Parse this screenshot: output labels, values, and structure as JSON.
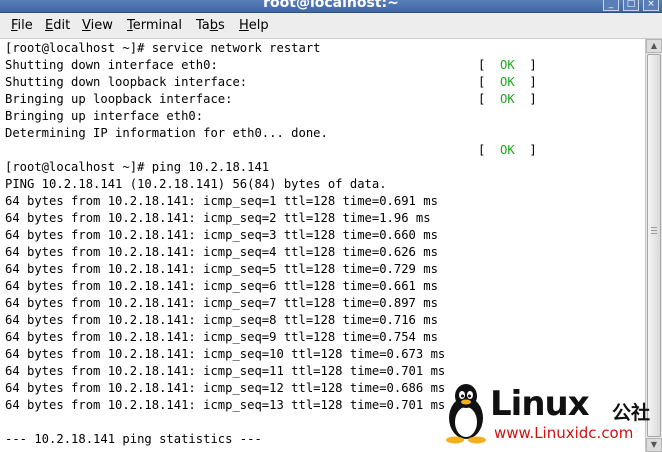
{
  "window": {
    "title": "root@localhost:~",
    "buttons": {
      "minimize": "_",
      "maximize": "□",
      "close": "×"
    }
  },
  "menubar": {
    "items": [
      {
        "label": "File",
        "mnemonic": "F",
        "rest": "ile"
      },
      {
        "label": "Edit",
        "mnemonic": "E",
        "rest": "dit"
      },
      {
        "label": "View",
        "mnemonic": "V",
        "rest": "iew"
      },
      {
        "label": "Terminal",
        "mnemonic": "T",
        "rest": "erminal"
      },
      {
        "label": "Tabs",
        "pre": "Ta",
        "mnemonic": "b",
        "rest": "s"
      },
      {
        "label": "Help",
        "mnemonic": "H",
        "rest": "elp"
      }
    ]
  },
  "terminal": {
    "lines": [
      "[root@localhost ~]# service network restart",
      "Shutting down interface eth0:",
      "Shutting down loopback interface:",
      "Bringing up loopback interface:",
      "Bringing up interface eth0:",
      "Determining IP information for eth0... done.",
      "",
      "[root@localhost ~]# ping 10.2.18.141",
      "PING 10.2.18.141 (10.2.18.141) 56(84) bytes of data.",
      "64 bytes from 10.2.18.141: icmp_seq=1 ttl=128 time=0.691 ms",
      "64 bytes from 10.2.18.141: icmp_seq=2 ttl=128 time=1.96 ms",
      "64 bytes from 10.2.18.141: icmp_seq=3 ttl=128 time=0.660 ms",
      "64 bytes from 10.2.18.141: icmp_seq=4 ttl=128 time=0.626 ms",
      "64 bytes from 10.2.18.141: icmp_seq=5 ttl=128 time=0.729 ms",
      "64 bytes from 10.2.18.141: icmp_seq=6 ttl=128 time=0.661 ms",
      "64 bytes from 10.2.18.141: icmp_seq=7 ttl=128 time=0.897 ms",
      "64 bytes from 10.2.18.141: icmp_seq=8 ttl=128 time=0.716 ms",
      "64 bytes from 10.2.18.141: icmp_seq=9 ttl=128 time=0.754 ms",
      "64 bytes from 10.2.18.141: icmp_seq=10 ttl=128 time=0.673 ms",
      "64 bytes from 10.2.18.141: icmp_seq=11 ttl=128 time=0.701 ms",
      "64 bytes from 10.2.18.141: icmp_seq=12 ttl=128 time=0.686 ms",
      "64 bytes from 10.2.18.141: icmp_seq=13 ttl=128 time=0.701 ms",
      "",
      "--- 10.2.18.141 ping statistics ---"
    ],
    "status_open": "[",
    "status_ok": "OK",
    "status_close": "]",
    "ok_color": "#1fa81f"
  },
  "watermark": {
    "brand": "Linux",
    "cn": "公社",
    "url": "www.Linuxidc.com",
    "url_color": "#d11111"
  },
  "icons": [
    "minimize-icon",
    "maximize-icon",
    "close-icon",
    "scroll-up-arrow-icon",
    "scroll-down-arrow-icon",
    "tux-penguin-icon"
  ]
}
